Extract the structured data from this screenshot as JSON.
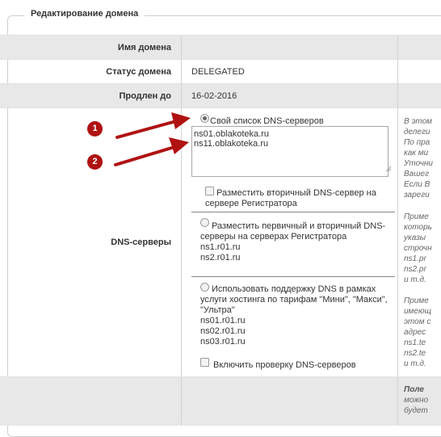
{
  "section": {
    "title": "Редактирование домена"
  },
  "rows": {
    "domain_name": {
      "label": "Имя домена",
      "value": ""
    },
    "domain_status": {
      "label": "Статус домена",
      "value": "DELEGATED"
    },
    "renewed_until": {
      "label": "Продлен до",
      "value": "16-02-2016"
    }
  },
  "dns": {
    "label": "DNS-серверы",
    "own_list": {
      "label": "Свой список DNS-серверов",
      "selected": true,
      "textarea_value": "ns01.oblakoteka.ru\nns11.oblakoteka.ru"
    },
    "secondary_checkbox": {
      "line1": "Разместить вторичный DNS-сервер на",
      "line2": "сервере Регистратора"
    },
    "registrar": {
      "line1": "Разместить первичный и вторичный DNS-",
      "line2": "серверы на серверах Регистратора",
      "servers": [
        "ns1.r01.ru",
        "ns2.r01.ru"
      ]
    },
    "hosting": {
      "line1": "Использовать поддержку DNS в рамках",
      "line2": "услуги хостинга по тарифам \"Мини\", \"Макси\",",
      "line3": "\"Ультра\"",
      "servers": [
        "ns01.r01.ru",
        "ns02.r01.ru",
        "ns03.r01.ru"
      ]
    },
    "check_dns": {
      "label": "Включить проверку DNS-серверов"
    }
  },
  "help_text": {
    "block1": [
      "В этом",
      "делеги",
      "По пра",
      "как ми",
      "Уточни",
      "Вашег",
      "Если В",
      "зареги"
    ],
    "block2": [
      "Приме",
      "которь",
      "указы",
      "строчн",
      "ns1.pr",
      "ns2.pr",
      "и т.д."
    ],
    "block3": [
      "Приме",
      "имеющ",
      "этом с",
      "адрес",
      "ns1.te",
      "ns2.te",
      "и т.д."
    ],
    "footer_bold": "Поле",
    "footer_lines": [
      "можно",
      "будет"
    ]
  },
  "annotations": {
    "badge1": "1",
    "badge2": "2",
    "arrow_color": "#b01212"
  }
}
